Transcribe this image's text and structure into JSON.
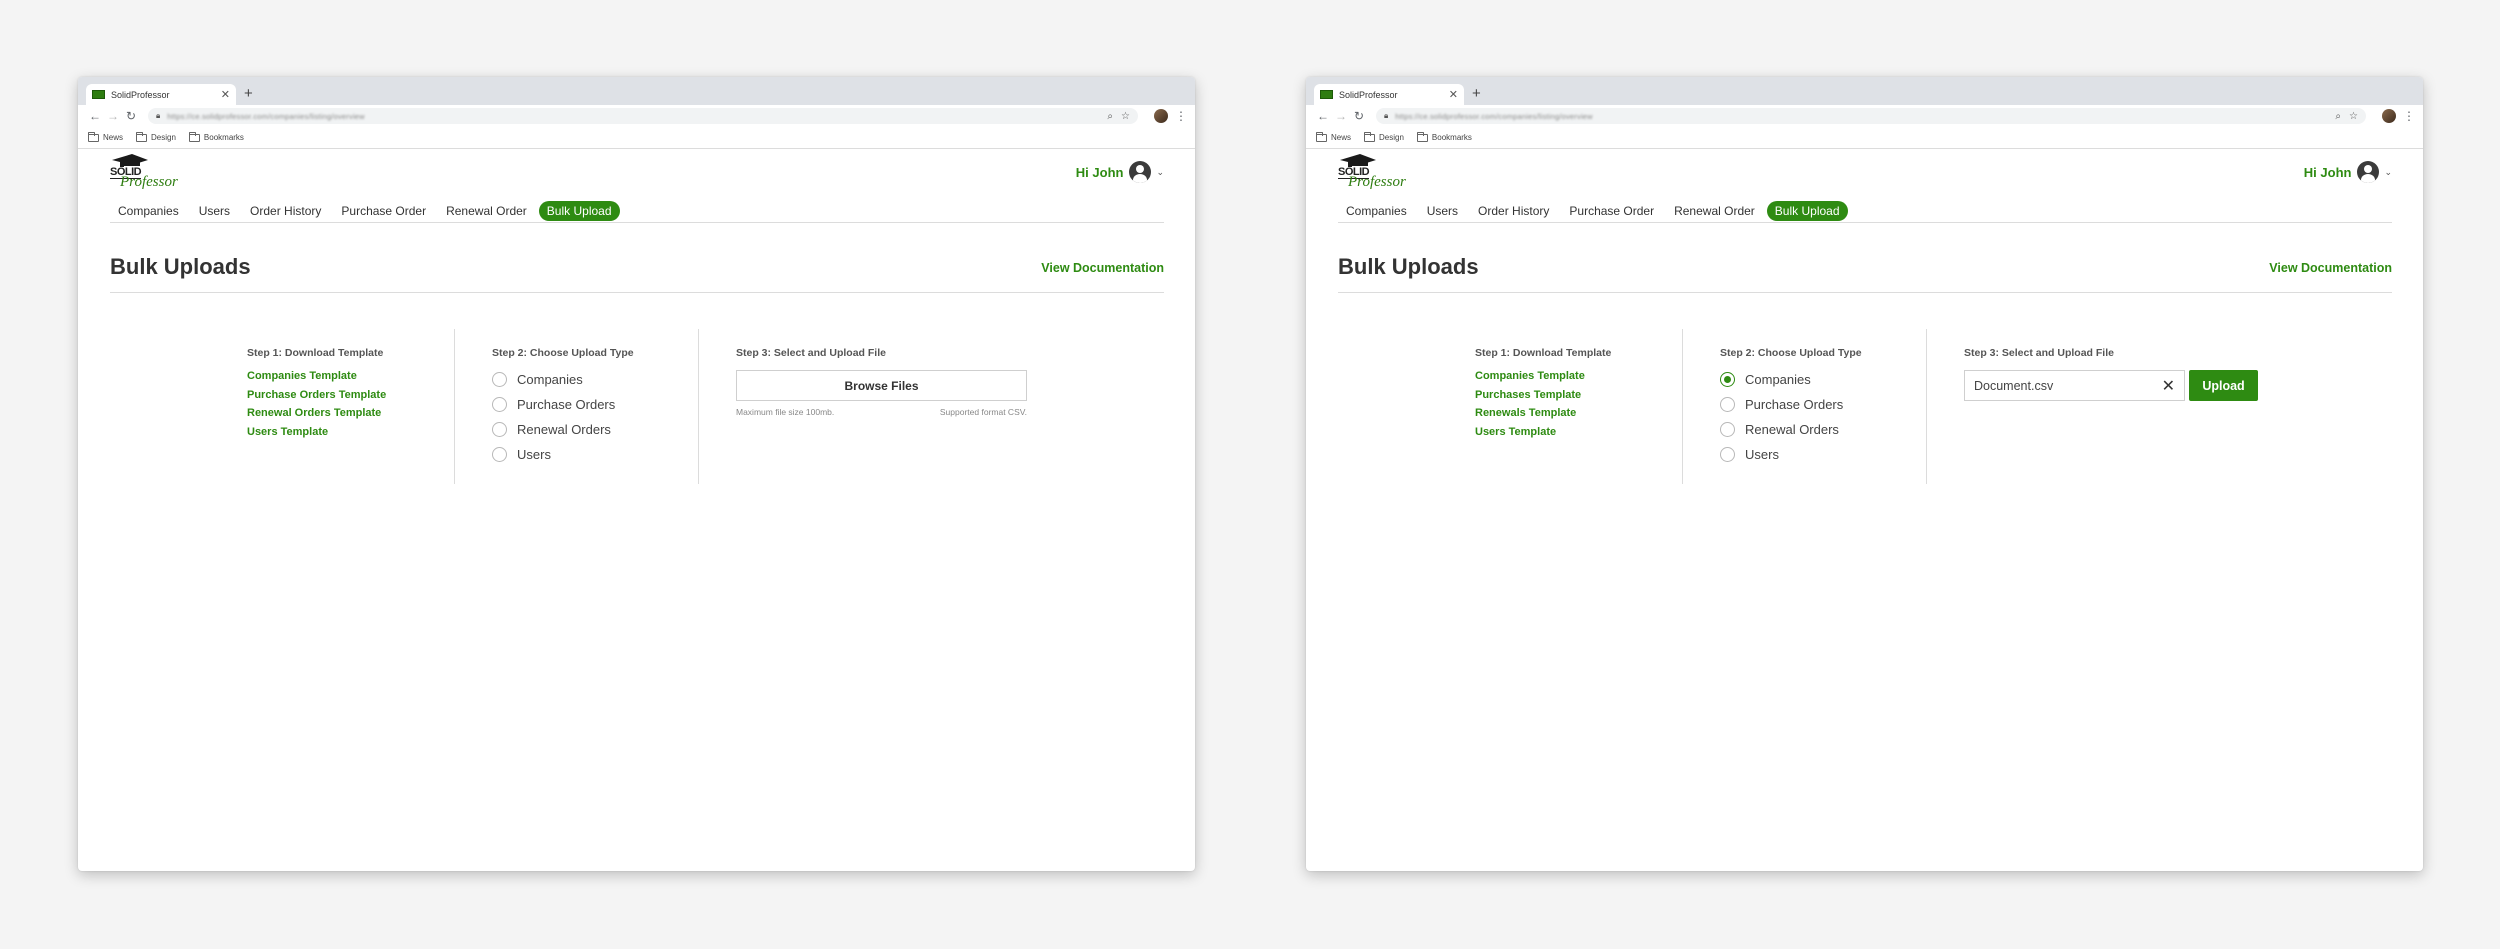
{
  "browser": {
    "tab_title": "SolidProfessor",
    "url": "https://ce.solidprofessor.com/companies/listing/overview",
    "bookmarks": [
      "News",
      "Design",
      "Bookmarks"
    ]
  },
  "logo": {
    "line1": "SOLID",
    "line2": "Professor"
  },
  "header": {
    "greeting": "Hi John"
  },
  "nav": [
    "Companies",
    "Users",
    "Order History",
    "Purchase Order",
    "Renewal Order",
    "Bulk Upload"
  ],
  "active_nav": "Bulk Upload",
  "page": {
    "title": "Bulk Uploads",
    "doc_link": "View Documentation"
  },
  "step1": {
    "title": "Step 1: Download Template"
  },
  "step2": {
    "title": "Step 2: Choose Upload Type",
    "options": [
      "Companies",
      "Purchase Orders",
      "Renewal Orders",
      "Users"
    ]
  },
  "step3": {
    "title": "Step 3: Select and Upload File"
  },
  "screens": {
    "left": {
      "templates": [
        "Companies Template",
        "Purchase Orders Template",
        "Renewal Orders Template",
        "Users Template"
      ],
      "browse_label": "Browse Files",
      "hint_size": "Maximum file size 100mb.",
      "hint_format": "Supported format CSV.",
      "selected_option": null
    },
    "right": {
      "templates": [
        "Companies Template",
        "Purchases Template",
        "Renewals Template",
        "Users Template"
      ],
      "file_name": "Document.csv",
      "upload_label": "Upload",
      "selected_option": "Companies"
    }
  },
  "colors": {
    "brand_green": "#2e8b12",
    "page_bg": "#f4f4f4"
  },
  "icons": [
    "back-icon",
    "forward-icon",
    "reload-icon",
    "lock-icon",
    "search-icon",
    "star-icon",
    "kebab-menu-icon",
    "folder-icon",
    "user-avatar-icon",
    "chevron-down-icon",
    "close-icon"
  ]
}
